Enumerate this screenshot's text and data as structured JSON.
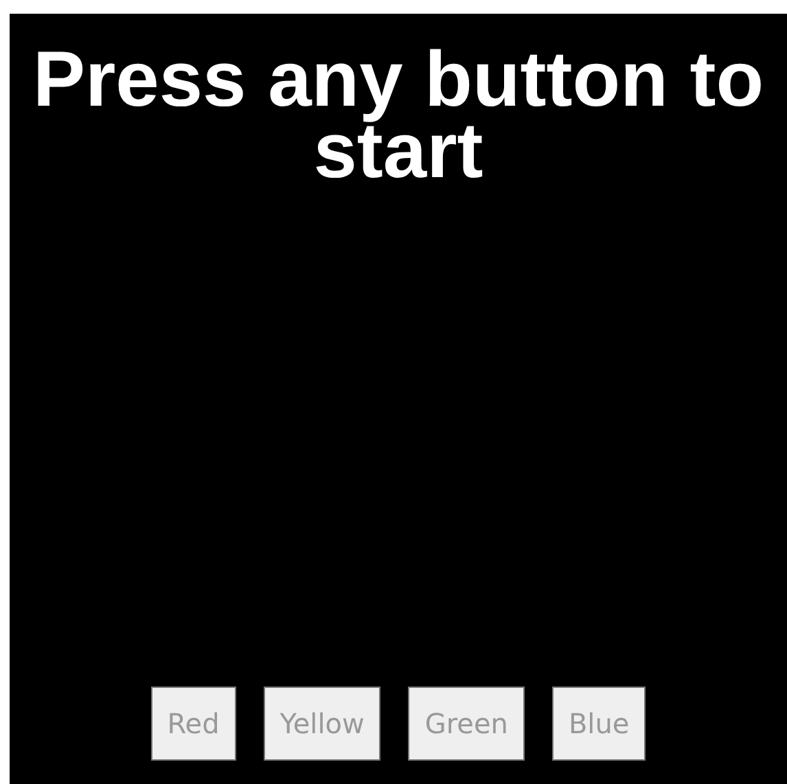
{
  "title": "Press any button to start",
  "buttons": [
    {
      "label": "Red"
    },
    {
      "label": "Yellow"
    },
    {
      "label": "Green"
    },
    {
      "label": "Blue"
    }
  ]
}
